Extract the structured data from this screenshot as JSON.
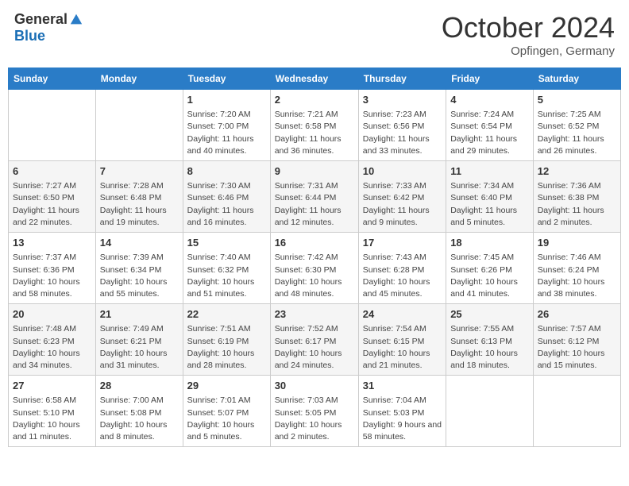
{
  "header": {
    "logo_general": "General",
    "logo_blue": "Blue",
    "month_title": "October 2024",
    "location": "Opfingen, Germany"
  },
  "columns": [
    "Sunday",
    "Monday",
    "Tuesday",
    "Wednesday",
    "Thursday",
    "Friday",
    "Saturday"
  ],
  "weeks": [
    [
      {
        "day": "",
        "info": ""
      },
      {
        "day": "",
        "info": ""
      },
      {
        "day": "1",
        "info": "Sunrise: 7:20 AM\nSunset: 7:00 PM\nDaylight: 11 hours and 40 minutes."
      },
      {
        "day": "2",
        "info": "Sunrise: 7:21 AM\nSunset: 6:58 PM\nDaylight: 11 hours and 36 minutes."
      },
      {
        "day": "3",
        "info": "Sunrise: 7:23 AM\nSunset: 6:56 PM\nDaylight: 11 hours and 33 minutes."
      },
      {
        "day": "4",
        "info": "Sunrise: 7:24 AM\nSunset: 6:54 PM\nDaylight: 11 hours and 29 minutes."
      },
      {
        "day": "5",
        "info": "Sunrise: 7:25 AM\nSunset: 6:52 PM\nDaylight: 11 hours and 26 minutes."
      }
    ],
    [
      {
        "day": "6",
        "info": "Sunrise: 7:27 AM\nSunset: 6:50 PM\nDaylight: 11 hours and 22 minutes."
      },
      {
        "day": "7",
        "info": "Sunrise: 7:28 AM\nSunset: 6:48 PM\nDaylight: 11 hours and 19 minutes."
      },
      {
        "day": "8",
        "info": "Sunrise: 7:30 AM\nSunset: 6:46 PM\nDaylight: 11 hours and 16 minutes."
      },
      {
        "day": "9",
        "info": "Sunrise: 7:31 AM\nSunset: 6:44 PM\nDaylight: 11 hours and 12 minutes."
      },
      {
        "day": "10",
        "info": "Sunrise: 7:33 AM\nSunset: 6:42 PM\nDaylight: 11 hours and 9 minutes."
      },
      {
        "day": "11",
        "info": "Sunrise: 7:34 AM\nSunset: 6:40 PM\nDaylight: 11 hours and 5 minutes."
      },
      {
        "day": "12",
        "info": "Sunrise: 7:36 AM\nSunset: 6:38 PM\nDaylight: 11 hours and 2 minutes."
      }
    ],
    [
      {
        "day": "13",
        "info": "Sunrise: 7:37 AM\nSunset: 6:36 PM\nDaylight: 10 hours and 58 minutes."
      },
      {
        "day": "14",
        "info": "Sunrise: 7:39 AM\nSunset: 6:34 PM\nDaylight: 10 hours and 55 minutes."
      },
      {
        "day": "15",
        "info": "Sunrise: 7:40 AM\nSunset: 6:32 PM\nDaylight: 10 hours and 51 minutes."
      },
      {
        "day": "16",
        "info": "Sunrise: 7:42 AM\nSunset: 6:30 PM\nDaylight: 10 hours and 48 minutes."
      },
      {
        "day": "17",
        "info": "Sunrise: 7:43 AM\nSunset: 6:28 PM\nDaylight: 10 hours and 45 minutes."
      },
      {
        "day": "18",
        "info": "Sunrise: 7:45 AM\nSunset: 6:26 PM\nDaylight: 10 hours and 41 minutes."
      },
      {
        "day": "19",
        "info": "Sunrise: 7:46 AM\nSunset: 6:24 PM\nDaylight: 10 hours and 38 minutes."
      }
    ],
    [
      {
        "day": "20",
        "info": "Sunrise: 7:48 AM\nSunset: 6:23 PM\nDaylight: 10 hours and 34 minutes."
      },
      {
        "day": "21",
        "info": "Sunrise: 7:49 AM\nSunset: 6:21 PM\nDaylight: 10 hours and 31 minutes."
      },
      {
        "day": "22",
        "info": "Sunrise: 7:51 AM\nSunset: 6:19 PM\nDaylight: 10 hours and 28 minutes."
      },
      {
        "day": "23",
        "info": "Sunrise: 7:52 AM\nSunset: 6:17 PM\nDaylight: 10 hours and 24 minutes."
      },
      {
        "day": "24",
        "info": "Sunrise: 7:54 AM\nSunset: 6:15 PM\nDaylight: 10 hours and 21 minutes."
      },
      {
        "day": "25",
        "info": "Sunrise: 7:55 AM\nSunset: 6:13 PM\nDaylight: 10 hours and 18 minutes."
      },
      {
        "day": "26",
        "info": "Sunrise: 7:57 AM\nSunset: 6:12 PM\nDaylight: 10 hours and 15 minutes."
      }
    ],
    [
      {
        "day": "27",
        "info": "Sunrise: 6:58 AM\nSunset: 5:10 PM\nDaylight: 10 hours and 11 minutes."
      },
      {
        "day": "28",
        "info": "Sunrise: 7:00 AM\nSunset: 5:08 PM\nDaylight: 10 hours and 8 minutes."
      },
      {
        "day": "29",
        "info": "Sunrise: 7:01 AM\nSunset: 5:07 PM\nDaylight: 10 hours and 5 minutes."
      },
      {
        "day": "30",
        "info": "Sunrise: 7:03 AM\nSunset: 5:05 PM\nDaylight: 10 hours and 2 minutes."
      },
      {
        "day": "31",
        "info": "Sunrise: 7:04 AM\nSunset: 5:03 PM\nDaylight: 9 hours and 58 minutes."
      },
      {
        "day": "",
        "info": ""
      },
      {
        "day": "",
        "info": ""
      }
    ]
  ]
}
